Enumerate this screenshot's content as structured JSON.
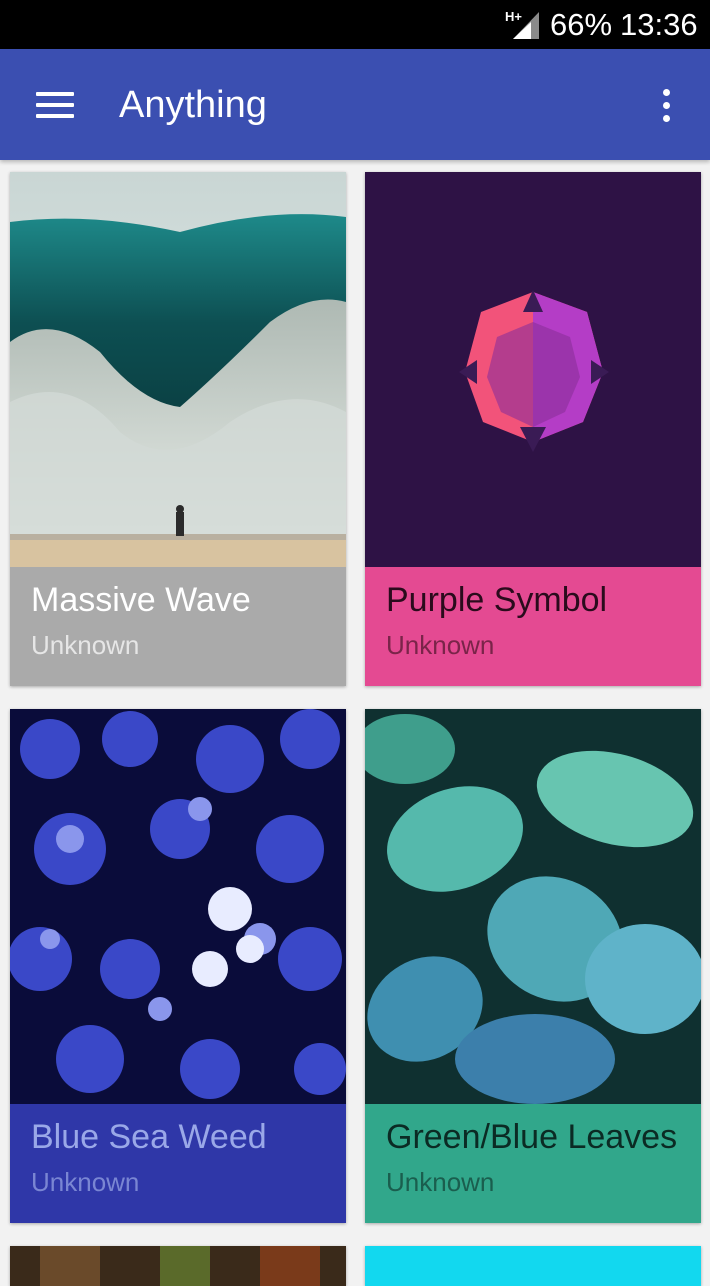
{
  "status_bar": {
    "network": "H+",
    "battery": "66%",
    "time": "13:36"
  },
  "app_bar": {
    "title": "Anything",
    "menu_icon": "menu-icon",
    "overflow_icon": "more-vert-icon",
    "color": "#3b4fb1"
  },
  "wallpapers": [
    {
      "title": "Massive Wave",
      "author": "Unknown",
      "caption_color": "#aaaaaa"
    },
    {
      "title": "Purple Symbol",
      "author": "Unknown",
      "caption_color": "#e44a92"
    },
    {
      "title": "Blue Sea Weed",
      "author": "Unknown",
      "caption_color": "#2f37a8"
    },
    {
      "title": "Green/Blue Leaves",
      "author": "Unknown",
      "caption_color": "#31a78b"
    }
  ]
}
